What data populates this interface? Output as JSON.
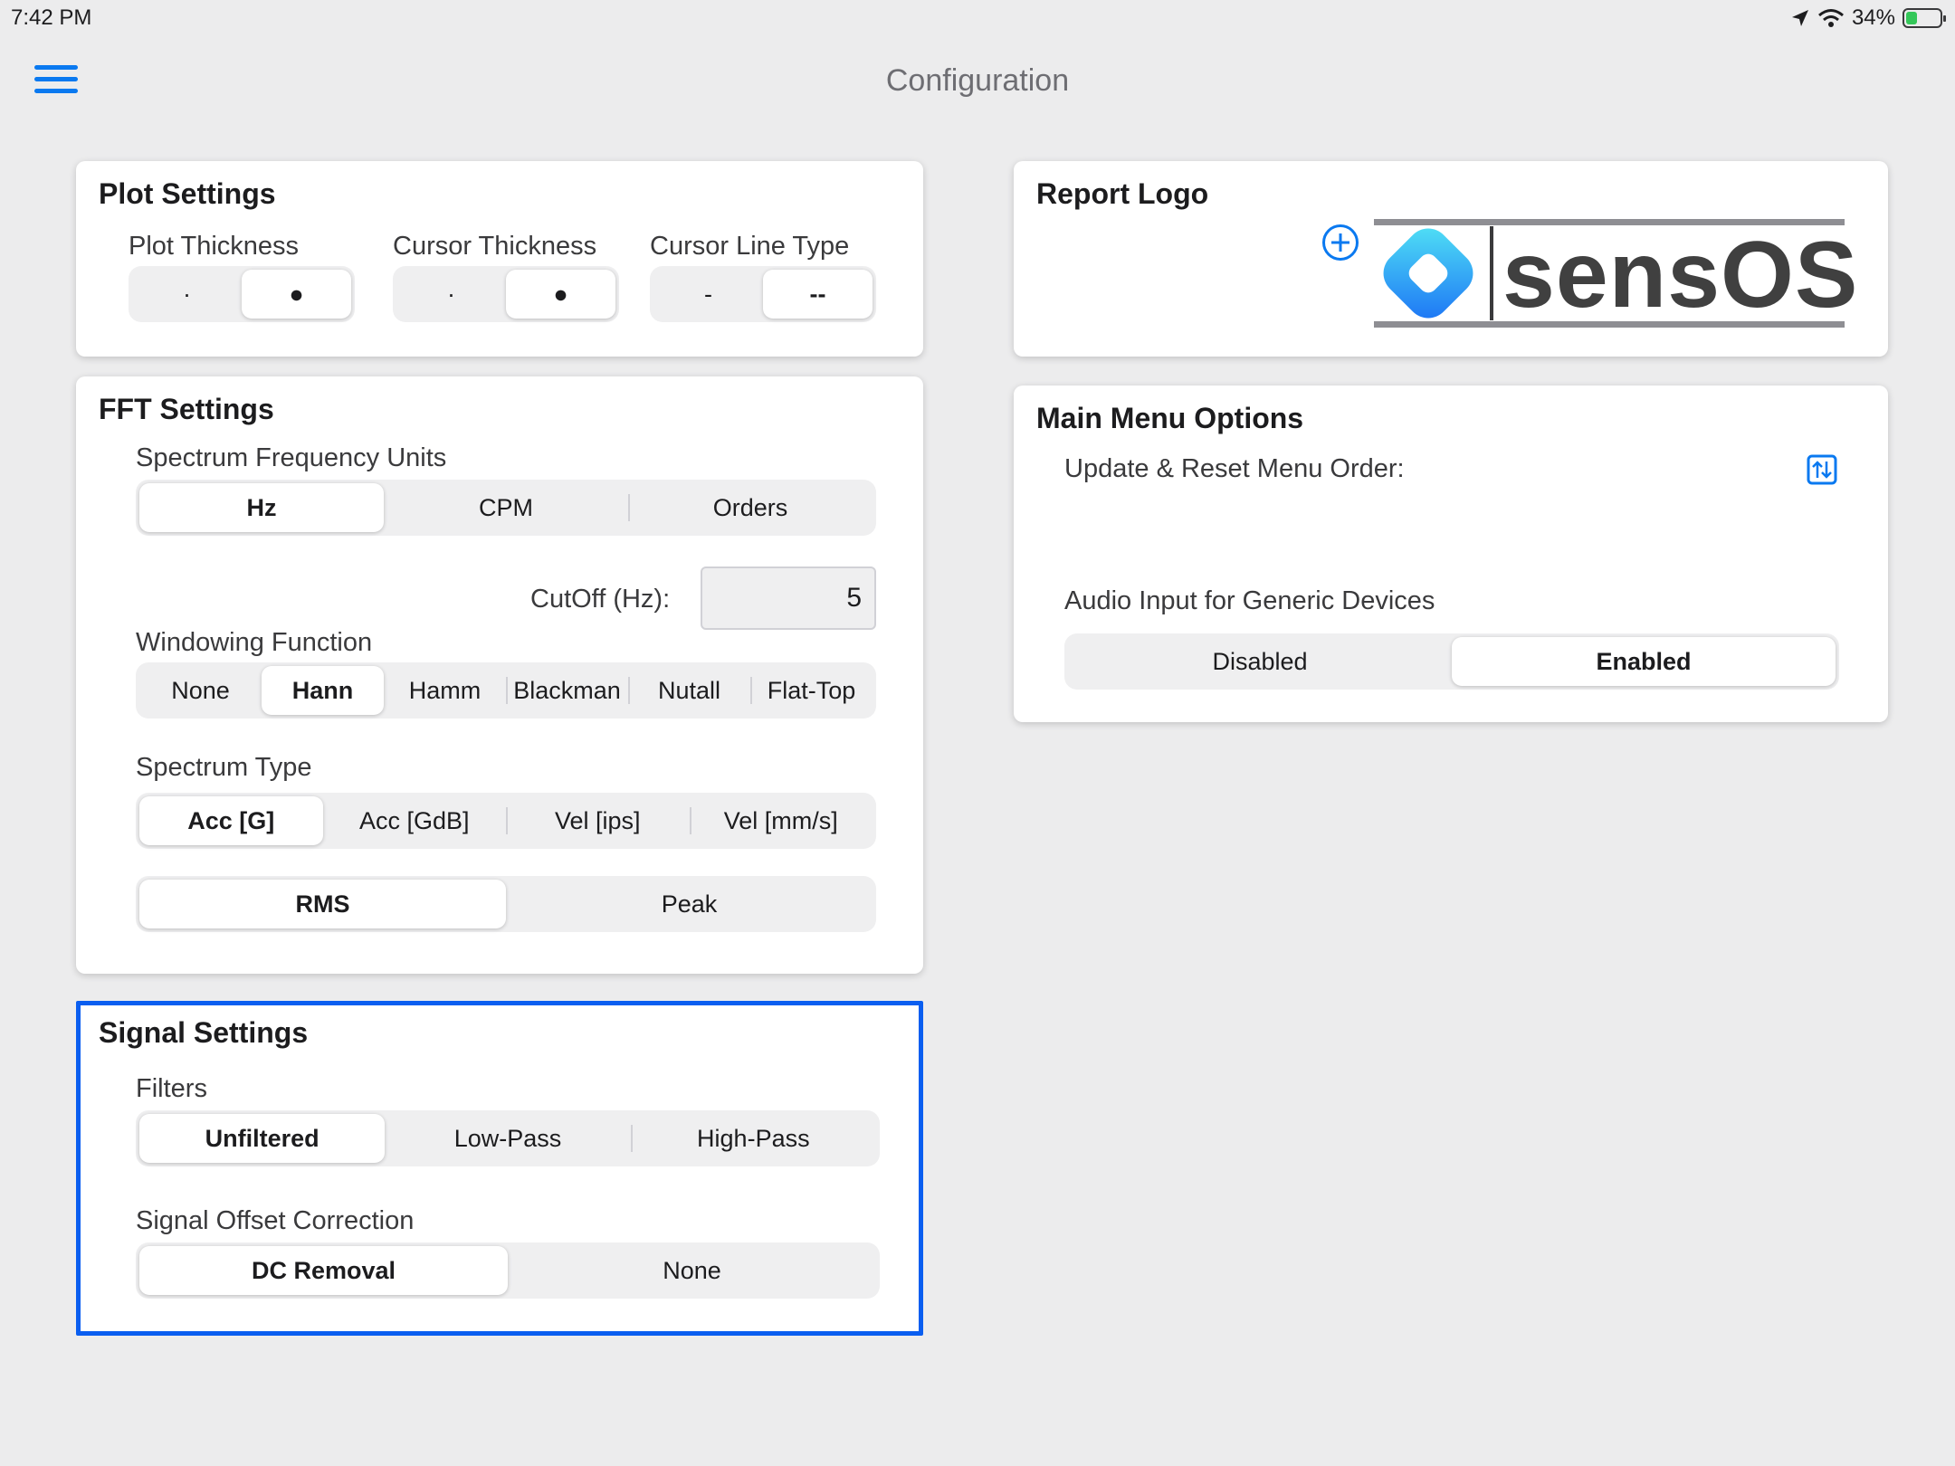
{
  "status_bar": {
    "time": "7:42 PM",
    "battery_percent": "34%",
    "battery_fill": 0.34
  },
  "header": {
    "title": "Configuration"
  },
  "plot_settings": {
    "title": "Plot Settings",
    "plot_thickness": {
      "label": "Plot Thickness",
      "options": [
        "·",
        "●"
      ],
      "selected_index": 1
    },
    "cursor_thickness": {
      "label": "Cursor Thickness",
      "options": [
        "·",
        "●"
      ],
      "selected_index": 1
    },
    "cursor_line_type": {
      "label": "Cursor Line Type",
      "options": [
        "-",
        "--"
      ],
      "selected_index": 1
    }
  },
  "fft_settings": {
    "title": "FFT Settings",
    "frequency_units": {
      "label": "Spectrum Frequency Units",
      "options": [
        "Hz",
        "CPM",
        "Orders"
      ],
      "selected_index": 0
    },
    "cutoff": {
      "label": "CutOff (Hz):",
      "value": "5"
    },
    "windowing": {
      "label": "Windowing Function",
      "options": [
        "None",
        "Hann",
        "Hamm",
        "Blackman",
        "Nutall",
        "Flat-Top"
      ],
      "selected_index": 1
    },
    "spectrum_type": {
      "label": "Spectrum Type",
      "options": [
        "Acc [G]",
        "Acc [GdB]",
        "Vel [ips]",
        "Vel [mm/s]"
      ],
      "selected_index": 0
    },
    "amplitude": {
      "options": [
        "RMS",
        "Peak"
      ],
      "selected_index": 0
    }
  },
  "signal_settings": {
    "title": "Signal Settings",
    "filters": {
      "label": "Filters",
      "options": [
        "Unfiltered",
        "Low-Pass",
        "High-Pass"
      ],
      "selected_index": 0
    },
    "offset_correction": {
      "label": "Signal Offset Correction",
      "options": [
        "DC Removal",
        "None"
      ],
      "selected_index": 0
    }
  },
  "report_logo": {
    "title": "Report Logo",
    "logo_text": "sensOS"
  },
  "main_menu": {
    "title": "Main Menu Options",
    "reorder_label": "Update & Reset Menu Order:",
    "audio_input": {
      "label": "Audio Input for Generic Devices",
      "options": [
        "Disabled",
        "Enabled"
      ],
      "selected_index": 1
    }
  },
  "colors": {
    "accent": "#0a79f0",
    "selection_border": "#0a5ef0",
    "background": "#ececed",
    "battery": "#34c759"
  }
}
